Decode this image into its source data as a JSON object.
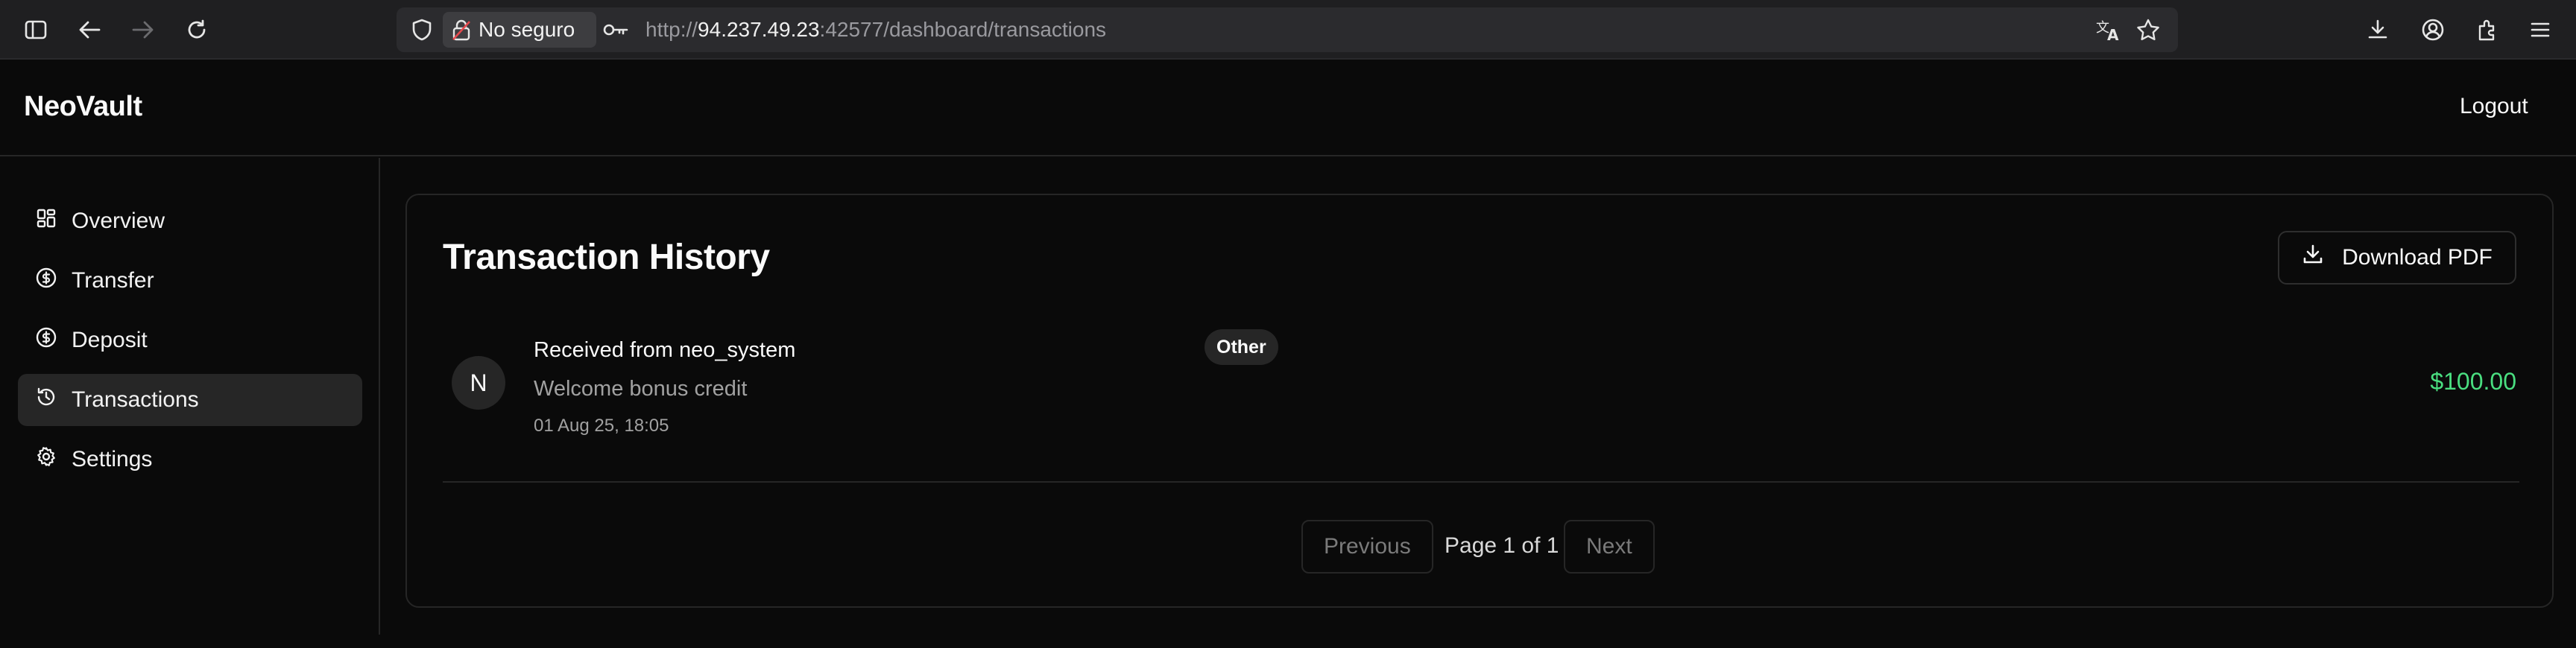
{
  "browser": {
    "security_label": "No seguro",
    "url_scheme": "http://",
    "url_host": "94.237.49.23",
    "url_rest": ":42577/dashboard/transactions"
  },
  "header": {
    "brand": "NeoVault",
    "logout_label": "Logout"
  },
  "sidebar": {
    "items": [
      {
        "label": "Overview",
        "icon": "grid-icon"
      },
      {
        "label": "Transfer",
        "icon": "dollar-circle-icon"
      },
      {
        "label": "Deposit",
        "icon": "dollar-circle-icon"
      },
      {
        "label": "Transactions",
        "icon": "history-icon",
        "active": true
      },
      {
        "label": "Settings",
        "icon": "gear-icon"
      }
    ]
  },
  "main": {
    "title": "Transaction History",
    "download_label": "Download PDF",
    "transactions": [
      {
        "avatar_initial": "N",
        "title": "Received from neo_system",
        "badge": "Other",
        "description": "Welcome bonus credit",
        "date": "01 Aug 25, 18:05",
        "amount": "$100.00"
      }
    ],
    "pagination": {
      "previous_label": "Previous",
      "page_text": "Page 1 of 1",
      "next_label": "Next"
    }
  },
  "colors": {
    "background": "#0a0a0a",
    "amount_positive": "#4ade80",
    "active_item": "#262626"
  }
}
